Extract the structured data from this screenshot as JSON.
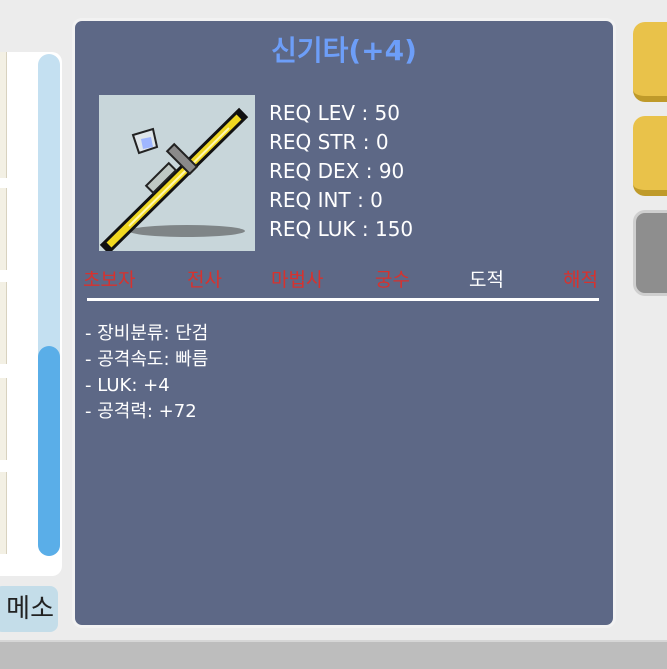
{
  "item": {
    "name": "신기타(+4)",
    "icon": "dagger-weapon-icon",
    "requirements": [
      "REQ LEV : 50",
      "REQ STR : 0",
      "REQ DEX : 90",
      "REQ INT : 0",
      "REQ LUK : 150"
    ],
    "jobs": [
      {
        "label": "초보자",
        "color": "#d7322e"
      },
      {
        "label": "전사",
        "color": "#d7322e"
      },
      {
        "label": "마법사",
        "color": "#d7322e"
      },
      {
        "label": "궁수",
        "color": "#d7322e"
      },
      {
        "label": "도적",
        "color": "#ffffff"
      },
      {
        "label": "해적",
        "color": "#d7322e"
      }
    ],
    "stats": [
      "- 장비분류: 단검",
      "- 공격속도: 빠름",
      "- LUK: +4",
      "- 공격력: +72"
    ]
  },
  "inventory": {
    "currency_label": "메소"
  }
}
